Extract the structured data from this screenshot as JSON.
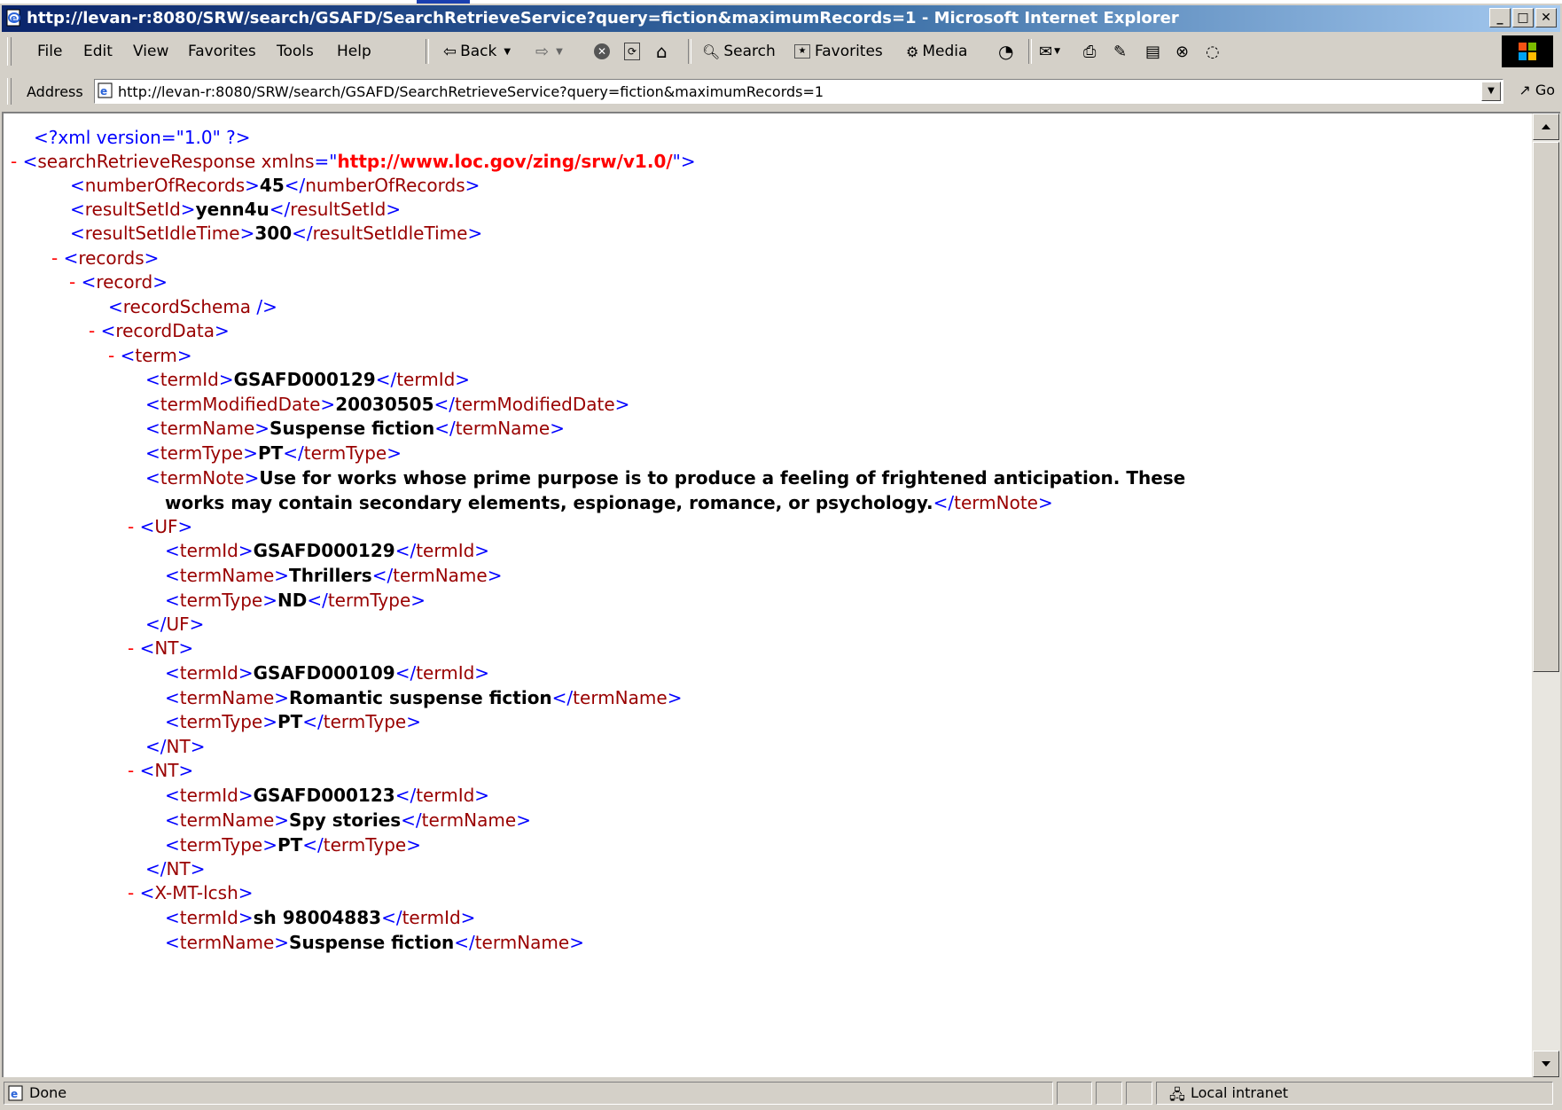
{
  "window": {
    "title": "http://levan-r:8080/SRW/search/GSAFD/SearchRetrieveService?query=fiction&maximumRecords=1 - Microsoft Internet Explorer",
    "minimize": "_",
    "maximize": "□",
    "close": "✕"
  },
  "menu": {
    "items": [
      "File",
      "Edit",
      "View",
      "Favorites",
      "Tools",
      "Help"
    ]
  },
  "toolbar": {
    "back": "Back",
    "search": "Search",
    "favorites": "Favorites",
    "media": "Media"
  },
  "address": {
    "label": "Address",
    "url": "http://levan-r:8080/SRW/search/GSAFD/SearchRetrieveService?query=fiction&maximumRecords=1",
    "go": "Go"
  },
  "xml": {
    "decl": "<?xml version=\"1.0\" ?>",
    "root_tag": "searchRetrieveResponse",
    "root_attr_name": "xmlns",
    "root_attr_value": "http://www.loc.gov/zing/srw/v1.0/",
    "numberOfRecords": "45",
    "resultSetId": "yenn4u",
    "resultSetIdleTime": "300",
    "term": {
      "termId": "GSAFD000129",
      "termModifiedDate": "20030505",
      "termName": "Suspense fiction",
      "termType": "PT",
      "termNote_1": "Use for works whose prime purpose is to produce a feeling of frightened anticipation. These",
      "termNote_2": "works may contain secondary elements, espionage, romance, or psychology."
    },
    "uf": {
      "termId": "GSAFD000129",
      "termName": "Thrillers",
      "termType": "ND"
    },
    "nt1": {
      "termId": "GSAFD000109",
      "termName": "Romantic suspense fiction",
      "termType": "PT"
    },
    "nt2": {
      "termId": "GSAFD000123",
      "termName": "Spy stories",
      "termType": "PT"
    },
    "lcsh": {
      "tag": "X-MT-lcsh",
      "termId": "sh 98004883",
      "termName": "Suspense fiction"
    }
  },
  "status": {
    "text": "Done",
    "zone": "Local intranet"
  }
}
